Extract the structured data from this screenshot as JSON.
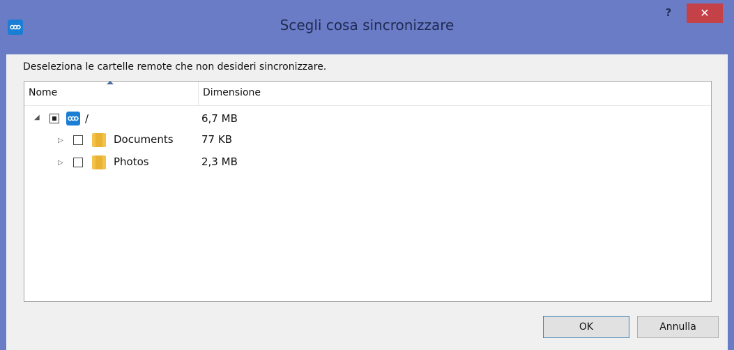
{
  "window": {
    "title": "Scegli cosa sincronizzare",
    "help_label": "?",
    "close_label": "✕"
  },
  "content": {
    "instruction": "Deseleziona le cartelle remote che non desideri sincronizzare."
  },
  "tree": {
    "columns": [
      "Nome",
      "Dimensione"
    ],
    "rows": [
      {
        "name": "/",
        "size": "6,7 MB",
        "checked": "partial",
        "icon": "cloud-icon"
      },
      {
        "name": "Documents",
        "size": "77 KB",
        "checked": false,
        "icon": "folder-icon"
      },
      {
        "name": "Photos",
        "size": "2,3 MB",
        "checked": false,
        "icon": "folder-icon"
      }
    ]
  },
  "buttons": {
    "ok": "OK",
    "cancel": "Annulla"
  },
  "colors": {
    "titlebar": "#6b7cc7",
    "close": "#c54148",
    "cloud": "#1a7ed4",
    "folder": "#f2c24b"
  }
}
